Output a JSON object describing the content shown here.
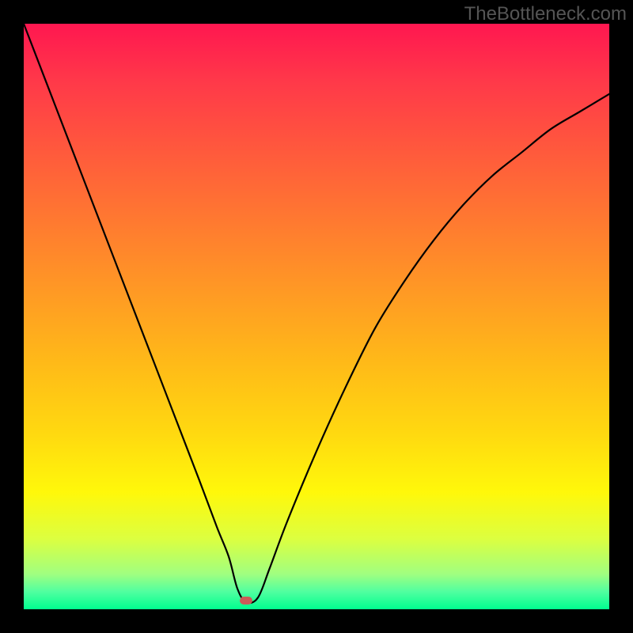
{
  "watermark": "TheBottleneck.com",
  "colors": {
    "page_bg": "#000000",
    "marker": "#cc5b58",
    "gradient_top": "#ff1750",
    "gradient_bottom": "#00ff8f",
    "curve": "#000000",
    "watermark_text": "#555555"
  },
  "chart_data": {
    "type": "line",
    "title": "",
    "xlabel": "",
    "ylabel": "",
    "x_range": [
      0,
      100
    ],
    "y_range": [
      0,
      100
    ],
    "annotations": [
      {
        "name": "minimum-marker",
        "x": 38,
        "y": 1.5
      }
    ],
    "series": [
      {
        "name": "bottleneck-curve",
        "x": [
          0,
          5,
          10,
          15,
          20,
          25,
          30,
          33,
          35,
          36.5,
          38,
          40,
          42,
          45,
          50,
          55,
          60,
          65,
          70,
          75,
          80,
          85,
          90,
          95,
          100
        ],
        "y": [
          100,
          87,
          74,
          61,
          48,
          35,
          22,
          14,
          9,
          3.5,
          1.2,
          2.0,
          7,
          15,
          27,
          38,
          48,
          56,
          63,
          69,
          74,
          78,
          82,
          85,
          88
        ]
      }
    ]
  }
}
